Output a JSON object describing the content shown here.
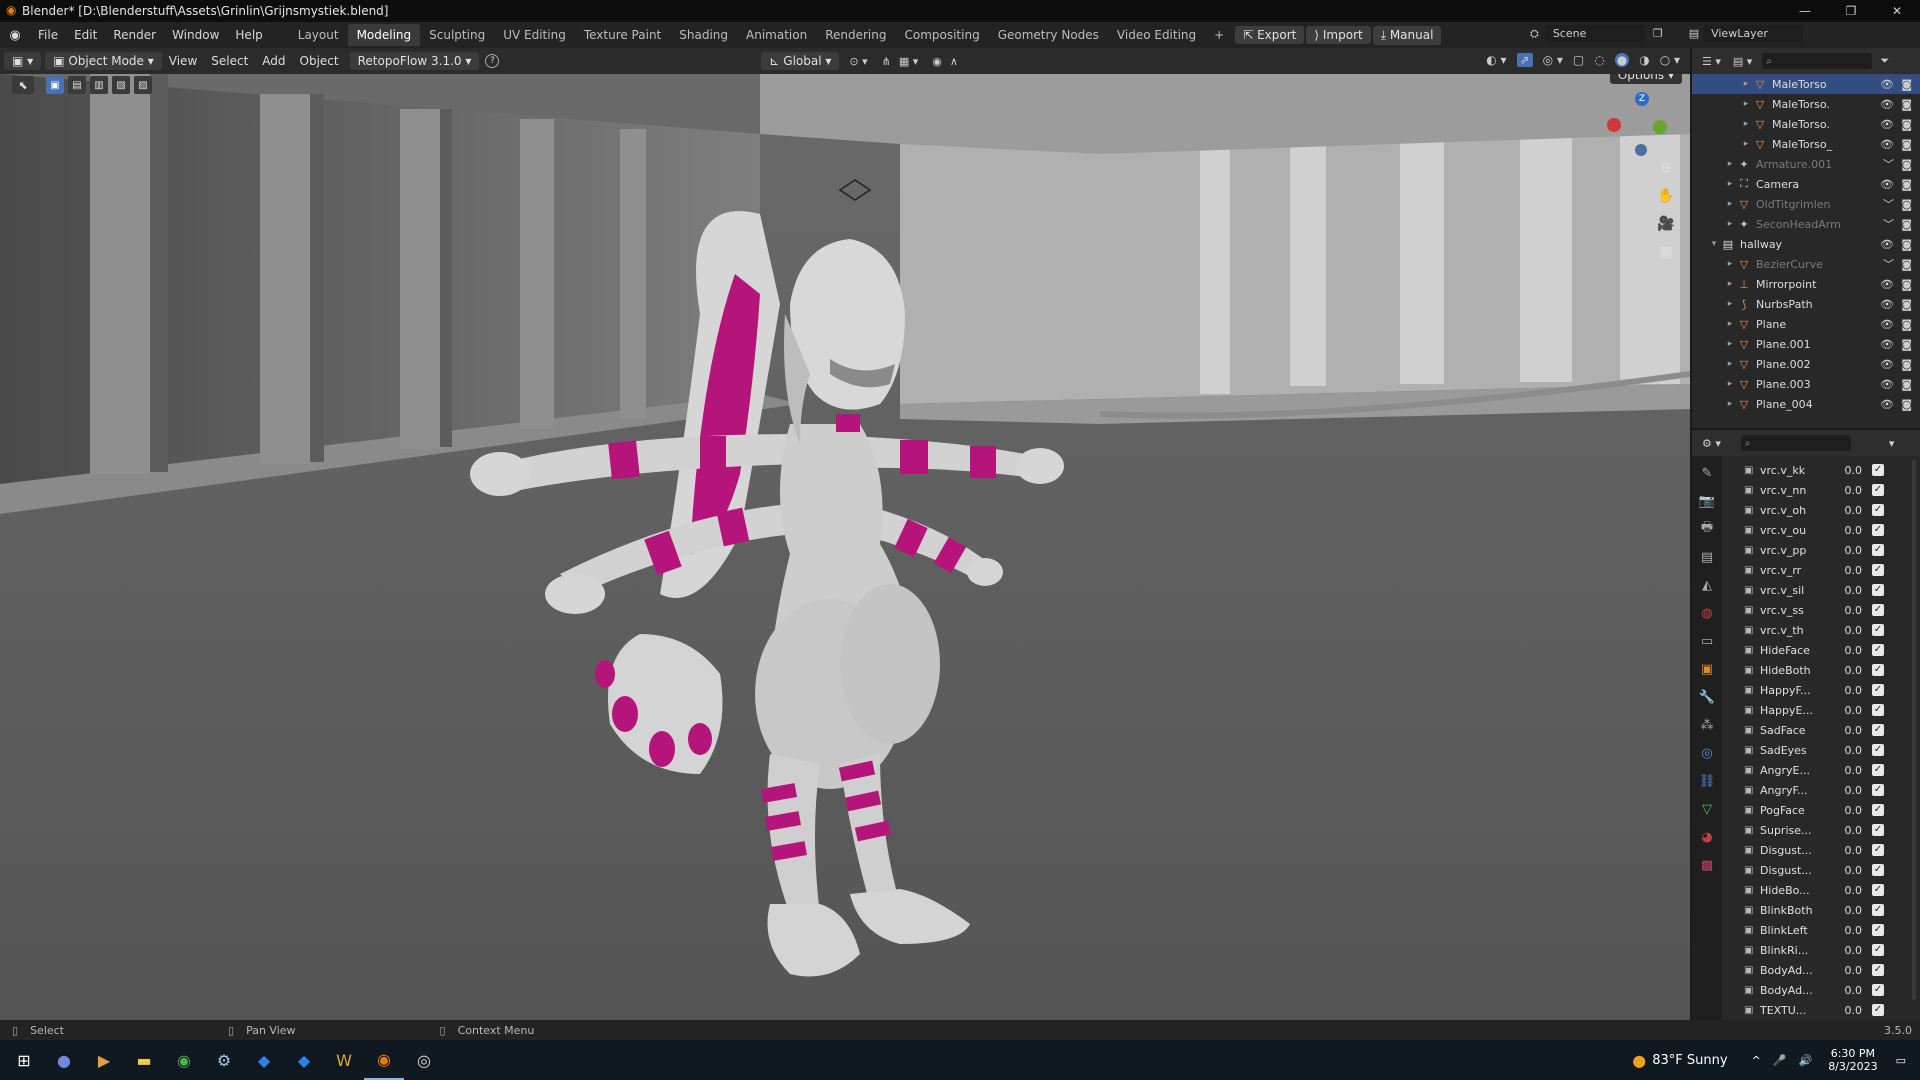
{
  "window": {
    "title": "Blender* [D:\\Blenderstuff\\Assets\\Grinlin\\Grijnsmystiek.blend]"
  },
  "menu": [
    "File",
    "Edit",
    "Render",
    "Window",
    "Help"
  ],
  "workspaces": [
    "Layout",
    "Modeling",
    "Sculpting",
    "UV Editing",
    "Texture Paint",
    "Shading",
    "Animation",
    "Rendering",
    "Compositing",
    "Geometry Nodes",
    "Video Editing"
  ],
  "active_workspace": "Modeling",
  "addon_buttons": {
    "export": "Export",
    "import": "Import",
    "manual": "Manual"
  },
  "scene": {
    "label": "Scene",
    "view_layer": "ViewLayer"
  },
  "viewport_header": {
    "mode": "Object Mode",
    "menus": [
      "View",
      "Select",
      "Add",
      "Object"
    ],
    "retopoflow": "RetopoFlow 3.1.0",
    "orientation": "Global",
    "options": "Options"
  },
  "outliner": {
    "rows": [
      {
        "name": "MaleTorso",
        "icon": "mesh-icon",
        "sel": true,
        "dim": false,
        "indent": 3
      },
      {
        "name": "MaleTorso.",
        "icon": "mesh-icon",
        "sel": false,
        "dim": false,
        "indent": 3
      },
      {
        "name": "MaleTorso.",
        "icon": "mesh-icon",
        "sel": false,
        "dim": false,
        "indent": 3
      },
      {
        "name": "MaleTorso_",
        "icon": "mesh-icon",
        "sel": false,
        "dim": false,
        "indent": 3
      },
      {
        "name": "Armature.001",
        "icon": "armature-icon",
        "sel": false,
        "dim": true,
        "indent": 2
      },
      {
        "name": "Camera",
        "icon": "camera-icon",
        "sel": false,
        "dim": false,
        "indent": 2
      },
      {
        "name": "OldTitgrimlen",
        "icon": "mesh-icon",
        "sel": false,
        "dim": true,
        "indent": 2
      },
      {
        "name": "SeconHeadArm",
        "icon": "armature-icon",
        "sel": false,
        "dim": true,
        "indent": 2
      },
      {
        "name": "hallway",
        "icon": "collection-icon",
        "sel": false,
        "dim": false,
        "indent": 1
      },
      {
        "name": "BezierCurve",
        "icon": "mesh-icon",
        "sel": false,
        "dim": true,
        "indent": 2
      },
      {
        "name": "Mirrorpoint",
        "icon": "empty-icon",
        "sel": false,
        "dim": false,
        "indent": 2
      },
      {
        "name": "NurbsPath",
        "icon": "curve-icon",
        "sel": false,
        "dim": false,
        "indent": 2
      },
      {
        "name": "Plane",
        "icon": "mesh-icon",
        "sel": false,
        "dim": false,
        "indent": 2
      },
      {
        "name": "Plane.001",
        "icon": "mesh-icon",
        "sel": false,
        "dim": false,
        "indent": 2
      },
      {
        "name": "Plane.002",
        "icon": "mesh-icon",
        "sel": false,
        "dim": false,
        "indent": 2
      },
      {
        "name": "Plane.003",
        "icon": "mesh-icon",
        "sel": false,
        "dim": false,
        "indent": 2
      },
      {
        "name": "Plane_004",
        "icon": "mesh-icon",
        "sel": false,
        "dim": false,
        "indent": 2
      }
    ]
  },
  "shape_keys": [
    {
      "name": "vrc.v_kk",
      "value": "0.0"
    },
    {
      "name": "vrc.v_nn",
      "value": "0.0"
    },
    {
      "name": "vrc.v_oh",
      "value": "0.0"
    },
    {
      "name": "vrc.v_ou",
      "value": "0.0"
    },
    {
      "name": "vrc.v_pp",
      "value": "0.0"
    },
    {
      "name": "vrc.v_rr",
      "value": "0.0"
    },
    {
      "name": "vrc.v_sil",
      "value": "0.0"
    },
    {
      "name": "vrc.v_ss",
      "value": "0.0"
    },
    {
      "name": "vrc.v_th",
      "value": "0.0"
    },
    {
      "name": "HideFace",
      "value": "0.0"
    },
    {
      "name": "HideBoth",
      "value": "0.0"
    },
    {
      "name": "HappyF...",
      "value": "0.0"
    },
    {
      "name": "HappyE...",
      "value": "0.0"
    },
    {
      "name": "SadFace",
      "value": "0.0"
    },
    {
      "name": "SadEyes",
      "value": "0.0"
    },
    {
      "name": "AngryE...",
      "value": "0.0"
    },
    {
      "name": "AngryF...",
      "value": "0.0"
    },
    {
      "name": "PogFace",
      "value": "0.0"
    },
    {
      "name": "Suprise...",
      "value": "0.0"
    },
    {
      "name": "Disgust...",
      "value": "0.0"
    },
    {
      "name": "Disgust...",
      "value": "0.0"
    },
    {
      "name": "HideBo...",
      "value": "0.0"
    },
    {
      "name": "BlinkBoth",
      "value": "0.0"
    },
    {
      "name": "BlinkLeft",
      "value": "0.0"
    },
    {
      "name": "BlinkRi...",
      "value": "0.0"
    },
    {
      "name": "BodyAd...",
      "value": "0.0"
    },
    {
      "name": "BodyAd...",
      "value": "0.0"
    },
    {
      "name": "TEXTU...",
      "value": "0.0"
    }
  ],
  "statusbar": {
    "select": "Select",
    "pan": "Pan View",
    "context": "Context Menu",
    "version": "3.5.0"
  },
  "taskbar": {
    "weather": "83°F  Sunny",
    "time": "6:30 PM",
    "date": "8/3/2023"
  },
  "colors": {
    "accent_magenta": "#b5147a",
    "selected_row": "#334d80"
  }
}
